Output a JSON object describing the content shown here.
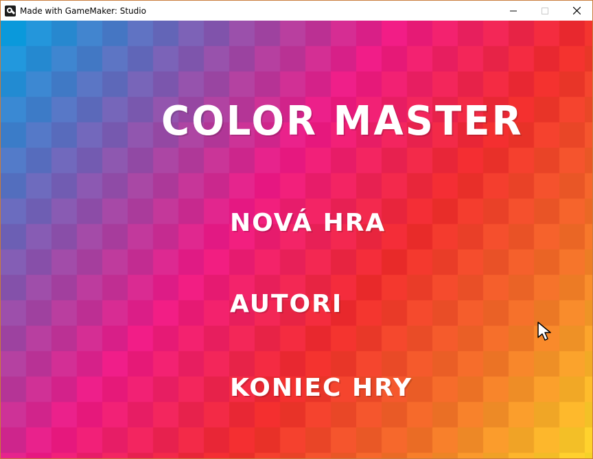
{
  "window": {
    "title": "Made with GameMaker: Studio",
    "minimize_icon": "minimize-icon",
    "maximize_icon": "maximize-icon",
    "close_icon": "close-icon"
  },
  "game": {
    "title": "COLOR MASTER",
    "menu": [
      {
        "label": "NOVÁ HRA"
      },
      {
        "label": "AUTORI"
      },
      {
        "label": "KONIEC HRY"
      }
    ],
    "text_color": "#ffffff",
    "gradient_colors": {
      "top_left": "#02a4e4",
      "middle": "#ec1a85",
      "top_right": "#ee2c2c",
      "bottom_right": "#fbd52a"
    }
  }
}
